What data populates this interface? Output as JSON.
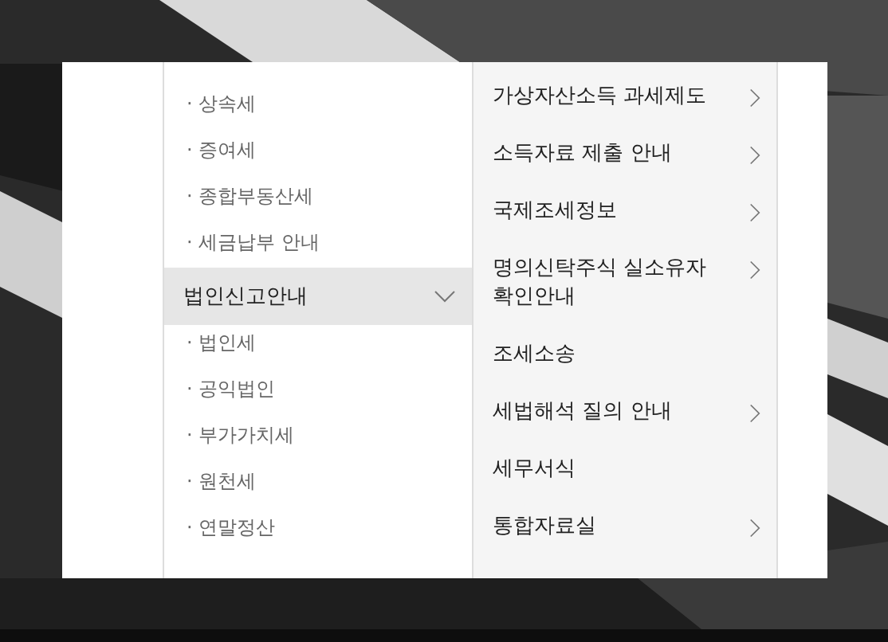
{
  "submenu": [
    {
      "kind": "item",
      "label": "· 상속세"
    },
    {
      "kind": "item",
      "label": "· 증여세"
    },
    {
      "kind": "item",
      "label": "· 종합부동산세"
    },
    {
      "kind": "item",
      "label": "· 세금납부 안내"
    },
    {
      "kind": "group",
      "label": "법인신고안내",
      "expanded": true
    },
    {
      "kind": "item",
      "label": "· 법인세"
    },
    {
      "kind": "item",
      "label": "· 공익법인"
    },
    {
      "kind": "item",
      "label": "· 부가가치세"
    },
    {
      "kind": "item",
      "label": "· 원천세"
    },
    {
      "kind": "item",
      "label": "· 연말정산"
    }
  ],
  "menu": [
    {
      "label": "가상자산소득 과세제도",
      "has_submenu": true
    },
    {
      "label": "소득자료 제출 안내",
      "has_submenu": true
    },
    {
      "label": "국제조세정보",
      "has_submenu": true
    },
    {
      "label": "명의신탁주식 실소유자 확인안내",
      "has_submenu": true
    },
    {
      "label": "조세소송",
      "has_submenu": false
    },
    {
      "label": "세법해석 질의 안내",
      "has_submenu": true
    },
    {
      "label": "세무서식",
      "has_submenu": false
    },
    {
      "label": "통합자료실",
      "has_submenu": true
    }
  ]
}
